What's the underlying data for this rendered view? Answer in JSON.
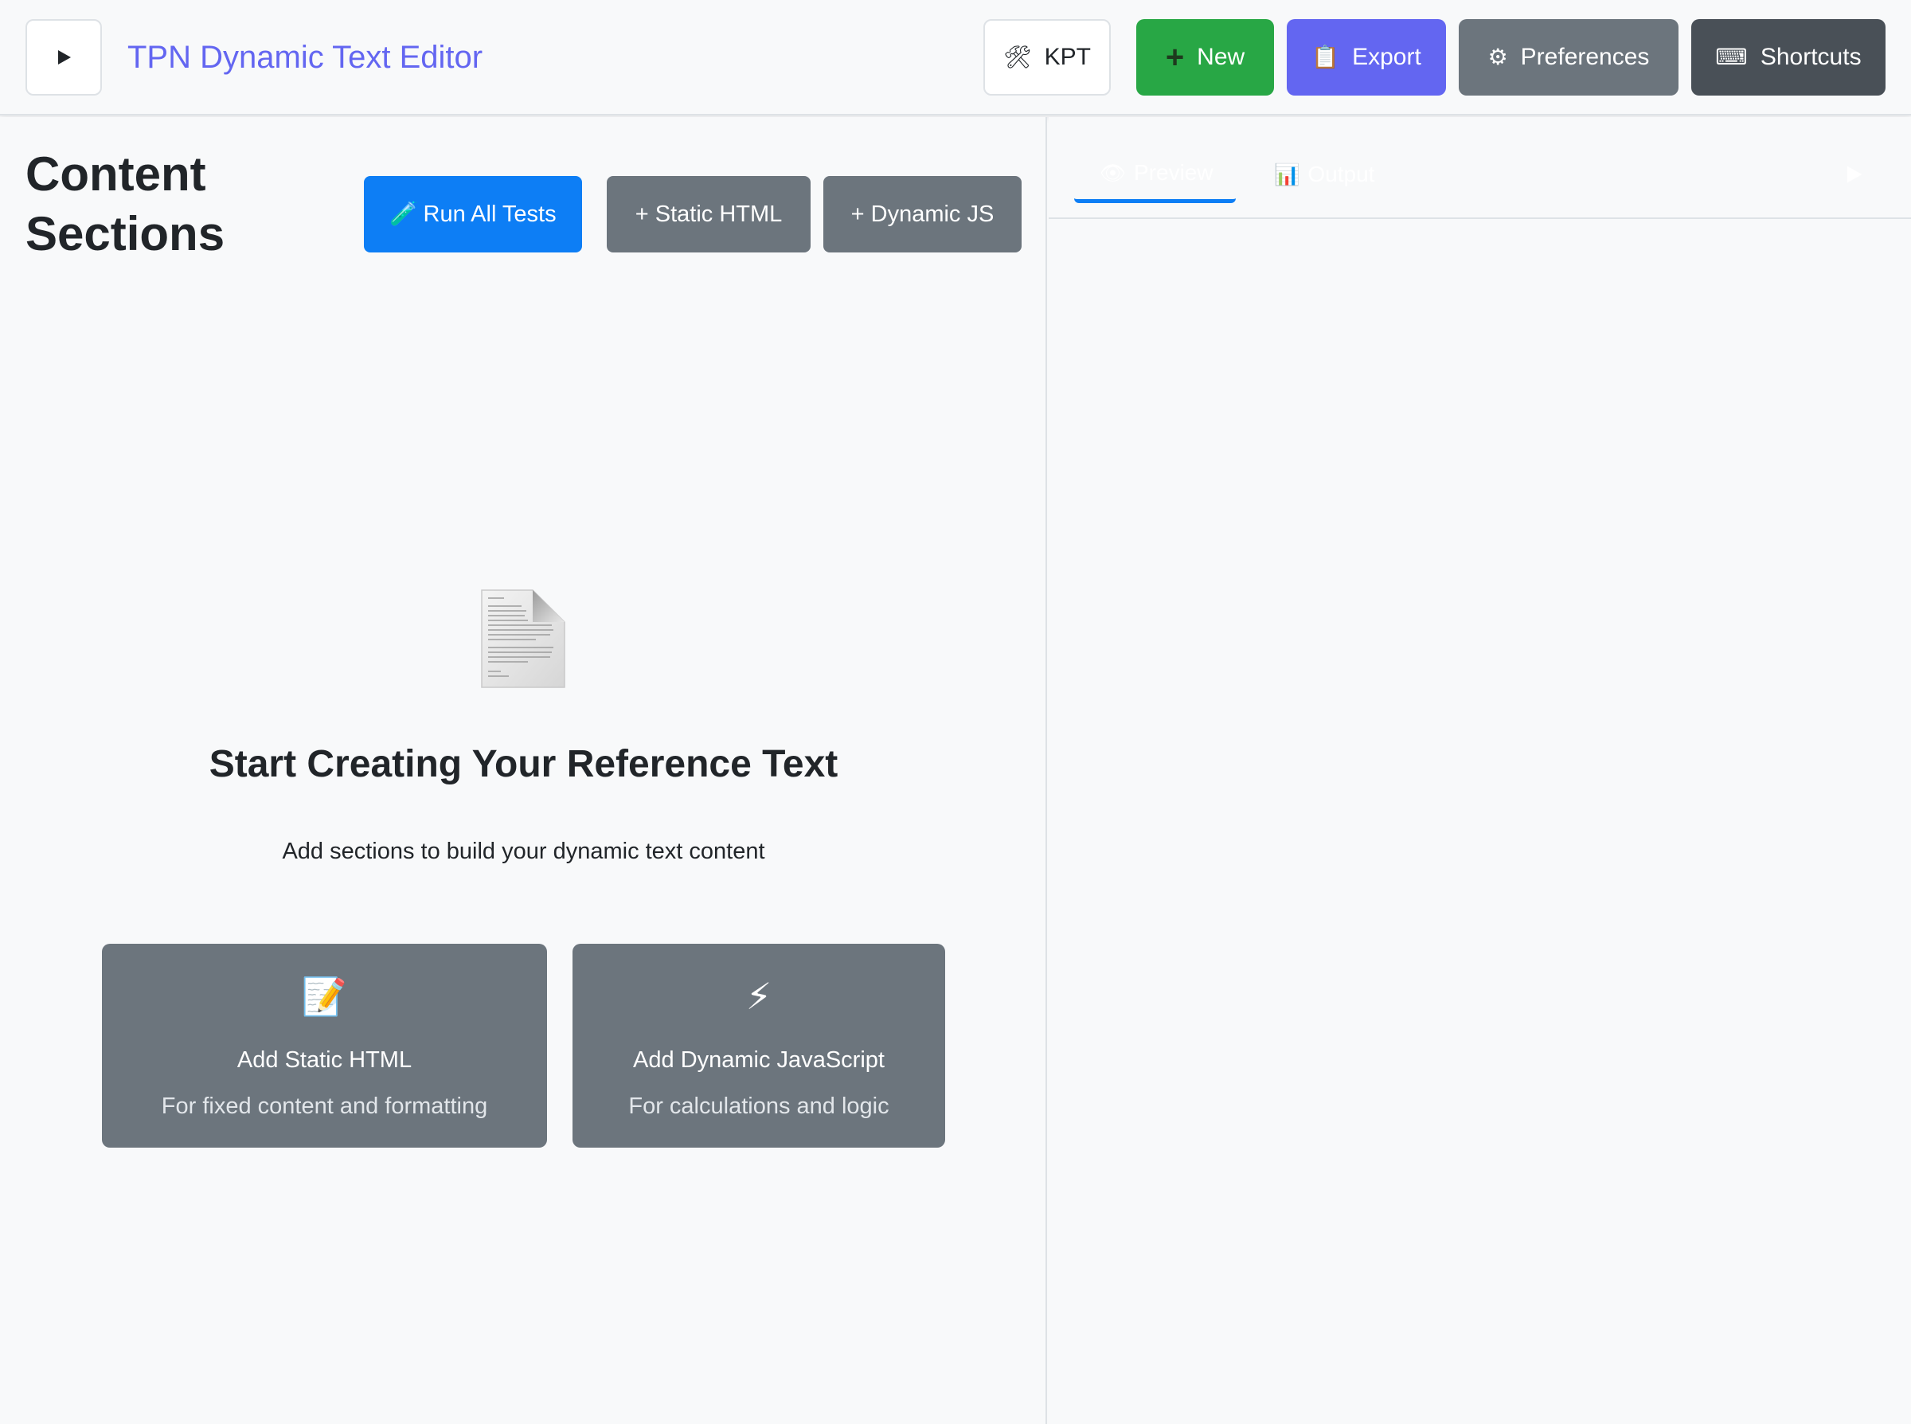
{
  "header": {
    "title": "TPN Dynamic Text Editor",
    "kpt_icon": "🛠",
    "kpt_label": "KPT",
    "new_icon": "+",
    "new_label": "New",
    "export_icon": "📋",
    "export_label": "Export",
    "preferences_icon": "⚙",
    "preferences_label": "Preferences",
    "shortcuts_icon": "⌨",
    "shortcuts_label": "Shortcuts"
  },
  "content": {
    "title": "Content Sections",
    "run_tests_icon": "🧪",
    "run_tests_label": "Run All Tests",
    "add_static_label": "+ Static HTML",
    "add_dynamic_label": "+ Dynamic JS",
    "empty_state": {
      "icon": "document-icon",
      "title": "Start Creating Your Reference Text",
      "subtitle": "Add sections to build your dynamic text content",
      "cards": [
        {
          "icon": "📝",
          "title": "Add Static HTML",
          "description": "For fixed content and formatting"
        },
        {
          "icon": "⚡",
          "title": "Add Dynamic JavaScript",
          "description": "For calculations and logic"
        }
      ]
    }
  },
  "preview_panel": {
    "tabs": [
      {
        "icon": "👁",
        "label": "Preview",
        "active": true
      },
      {
        "icon": "📊",
        "label": "Output",
        "active": false
      }
    ]
  },
  "colors": {
    "brand": "#6366f1",
    "primary": "#0d7ef5",
    "success": "#28a745",
    "secondary": "#6c757d",
    "dark": "#495057"
  }
}
